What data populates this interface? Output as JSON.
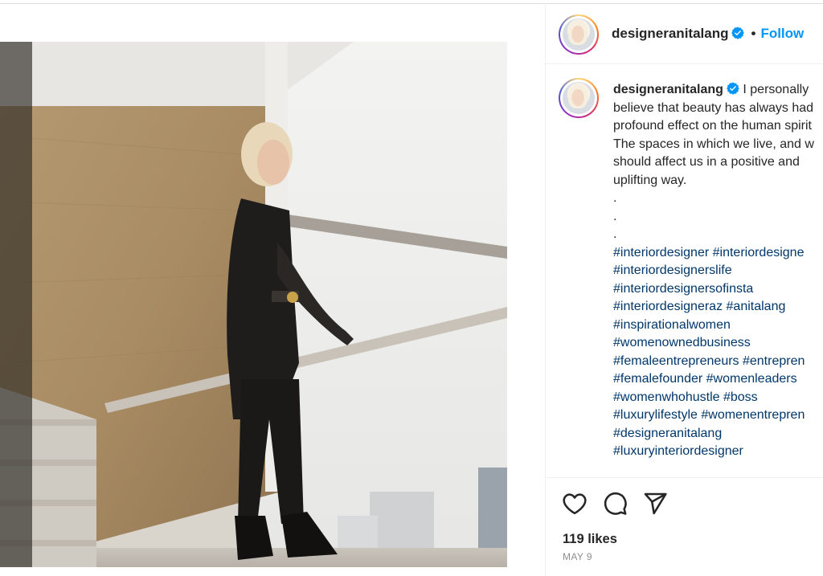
{
  "post": {
    "username": "designeranitalang",
    "follow_label": "Follow",
    "separator": "•",
    "caption_lines": [
      "I personally",
      "believe that beauty has always had",
      "profound effect on the human spirit",
      "The spaces in which we live, and w",
      "should affect us in a positive and",
      "uplifting way.",
      ".",
      ".",
      "."
    ],
    "hashtag_lines": [
      "#interiordesigner #interiordesigne",
      "#interiordesignerslife",
      "#interiordesignersofinsta",
      "#interiordesigneraz #anitalang",
      "#inspirationalwomen",
      "#womenownedbusiness",
      "#femaleentrepreneurs #entrepren",
      "#femalefounder #womenleaders",
      "#womenwhohustle #boss",
      "#luxurylifestyle #womenentrepren",
      "#designeranitalang",
      "#luxuryinteriordesigner"
    ],
    "likes": "119 likes",
    "date": "MAY 9"
  },
  "icons": {
    "like": "heart-icon",
    "comment": "comment-icon",
    "share": "paper-plane-icon",
    "verified": "verified-badge-icon"
  },
  "colors": {
    "accent": "#0095f6",
    "hashtag": "#00376b",
    "verified": "#0095f6",
    "muted": "#8e8e8e"
  }
}
